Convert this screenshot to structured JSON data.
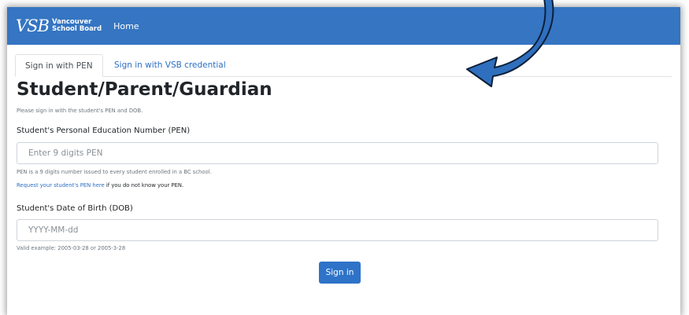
{
  "navbar": {
    "logo_mark": "VSB",
    "logo_line1": "Vancouver",
    "logo_line2": "School Board",
    "home_label": "Home",
    "color": "#3575c2"
  },
  "tabs": [
    {
      "label": "Sign in with PEN",
      "active": true
    },
    {
      "label": "Sign in with VSB credential",
      "active": false
    }
  ],
  "form": {
    "title": "Student/Parent/Guardian",
    "subtitle": "Please sign in with the student's PEN and DOB.",
    "pen_label": "Student's Personal Education Number (PEN)",
    "pen_placeholder": "Enter 9 digits PEN",
    "pen_help": "PEN is a 9 digits number issued to every student enrolled in a BC school.",
    "pen_request_link": "Request your student's PEN here",
    "pen_request_rest": " if you do not know your PEN.",
    "dob_label": "Student's Date of Birth (DOB)",
    "dob_placeholder": "YYYY-MM-dd",
    "dob_help": "Valid example: 2005-03-28 or 2005-3-28",
    "signin_label": "Sign in"
  },
  "annotation": {
    "arrow_icon": "curved-arrow-icon",
    "arrow_color": "#2f6fbd"
  }
}
